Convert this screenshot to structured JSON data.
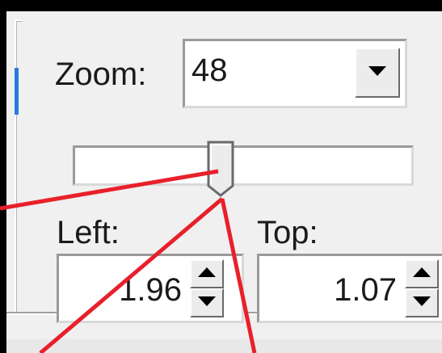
{
  "zoom": {
    "label": "Zoom:",
    "value": "48"
  },
  "slider": {
    "level_fraction": 0.42
  },
  "left": {
    "label": "Left:",
    "value": "1.96"
  },
  "top": {
    "label": "Top:",
    "value": "1.07"
  },
  "annotation_color": "#e8202a",
  "accent_color": "#2a7bde",
  "icons": [
    "dropdown-arrow-icon",
    "spin-up-arrow-icon",
    "spin-down-arrow-icon"
  ]
}
